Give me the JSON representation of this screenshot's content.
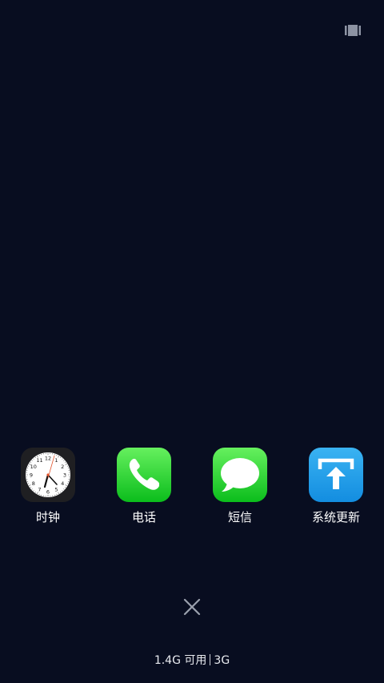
{
  "apps": [
    {
      "label": "时钟",
      "icon": "clock-icon"
    },
    {
      "label": "电话",
      "icon": "phone-icon"
    },
    {
      "label": "短信",
      "icon": "message-icon"
    },
    {
      "label": "系统更新",
      "icon": "system-update-icon"
    }
  ],
  "clock": {
    "numerals": [
      "12",
      "1",
      "2",
      "3",
      "4",
      "5",
      "6",
      "7",
      "8",
      "9",
      "10",
      "11"
    ]
  },
  "footer": {
    "storage_text": "1.4G 可用",
    "network_text": "3G"
  },
  "colors": {
    "background": "#080d20",
    "green_app": "#2fd83c",
    "blue_app": "#1e9fe8"
  }
}
